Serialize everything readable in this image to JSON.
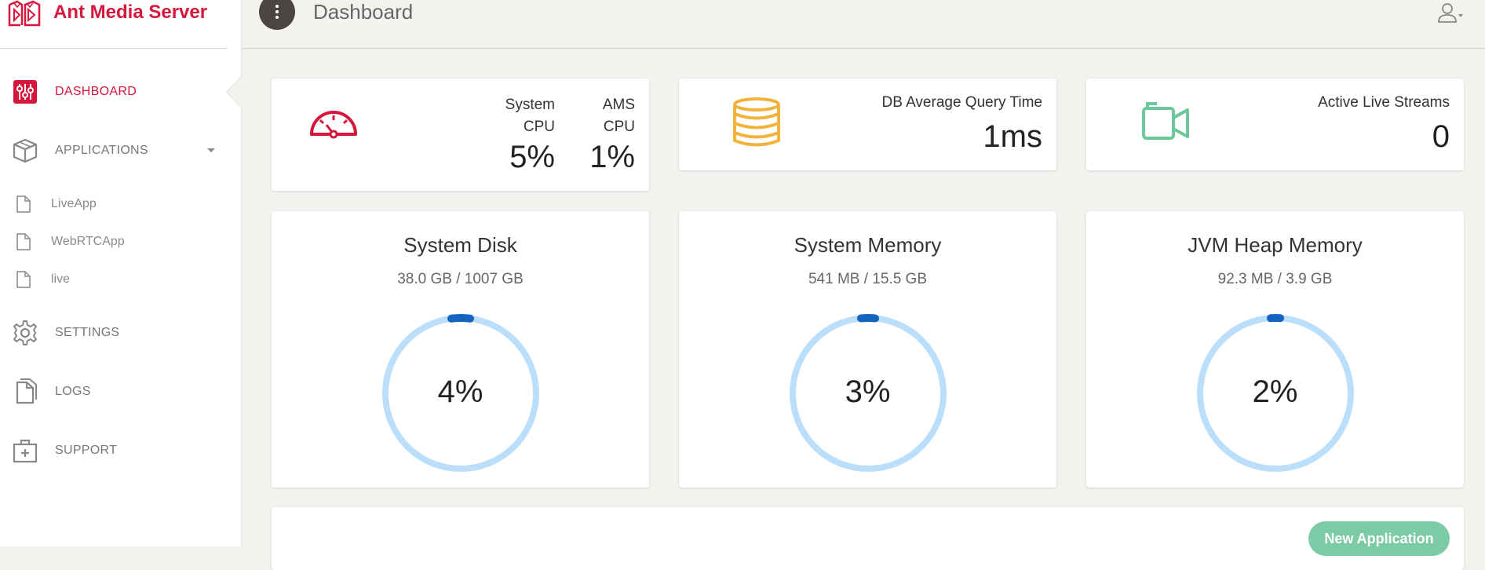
{
  "brand": {
    "name": "Ant Media Server",
    "logo_icon": "ant-media-logo-icon",
    "color": "#d6163b"
  },
  "sidebar": {
    "items": [
      {
        "label": "DASHBOARD",
        "icon": "sliders-icon",
        "active": true
      },
      {
        "label": "APPLICATIONS",
        "icon": "cube-icon",
        "expandable": true
      },
      {
        "label": "SETTINGS",
        "icon": "gear-icon"
      },
      {
        "label": "LOGS",
        "icon": "documents-icon"
      },
      {
        "label": "SUPPORT",
        "icon": "first-aid-icon"
      }
    ],
    "apps": [
      {
        "label": "LiveApp",
        "icon": "file-icon"
      },
      {
        "label": "WebRTCApp",
        "icon": "file-icon"
      },
      {
        "label": "live",
        "icon": "file-icon"
      }
    ]
  },
  "header": {
    "title": "Dashboard",
    "menu_icon": "vertical-dots-icon",
    "user_icon": "user-icon"
  },
  "stats": {
    "cpu": {
      "icon": "speedometer-icon",
      "system_label_1": "System",
      "system_label_2": "CPU",
      "system_value": "5%",
      "ams_label_1": "AMS",
      "ams_label_2": "CPU",
      "ams_value": "1%"
    },
    "db": {
      "icon": "database-icon",
      "title": "DB Average Query Time",
      "value": "1ms"
    },
    "streams": {
      "icon": "video-camera-icon",
      "title": "Active Live Streams",
      "value": "0"
    }
  },
  "gauges": [
    {
      "title": "System Disk",
      "usage": "38.0 GB / 1007 GB",
      "percent_text": "4%",
      "percent": 4
    },
    {
      "title": "System Memory",
      "usage": "541 MB / 15.5 GB",
      "percent_text": "3%",
      "percent": 3
    },
    {
      "title": "JVM Heap Memory",
      "usage": "92.3 MB / 3.9 GB",
      "percent_text": "2%",
      "percent": 2
    }
  ],
  "actions": {
    "new_application": "New Application"
  },
  "colors": {
    "accent": "#d6163b",
    "gauge_track": "#bbdefb",
    "gauge_fill": "#1565c0",
    "db_icon": "#f0b43c",
    "camera_icon": "#6cc79a",
    "new_app_button": "#7dcba4"
  }
}
